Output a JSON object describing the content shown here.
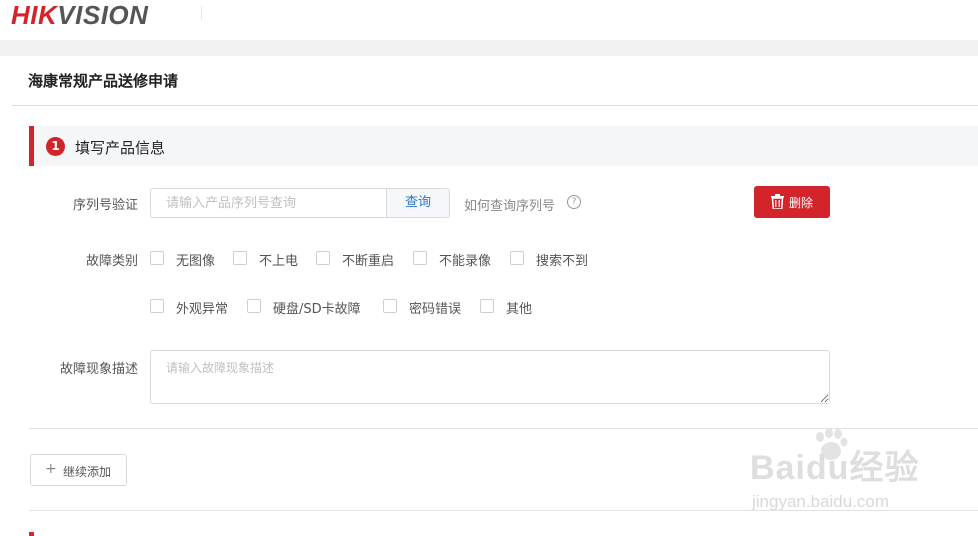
{
  "brand": {
    "logo_part1": "HIK",
    "logo_part2": "VISION"
  },
  "page": {
    "title": "海康常规产品送修申请"
  },
  "section1": {
    "step": "1",
    "title": "填写产品信息",
    "serial": {
      "label": "序列号验证",
      "placeholder": "请输入产品序列号查询",
      "value": "",
      "query_label": "查询",
      "howto_label": "如何查询序列号",
      "help_glyph": "?"
    },
    "delete_label": "删除",
    "fault_type": {
      "label": "故障类别",
      "options": [
        {
          "label": "无图像",
          "checked": false
        },
        {
          "label": "不上电",
          "checked": false
        },
        {
          "label": "不断重启",
          "checked": false
        },
        {
          "label": "不能录像",
          "checked": false
        },
        {
          "label": "搜索不到",
          "checked": false
        },
        {
          "label": "外观异常",
          "checked": false
        },
        {
          "label": "硬盘/SD卡故障",
          "checked": false
        },
        {
          "label": "密码错误",
          "checked": false
        },
        {
          "label": "其他",
          "checked": false
        }
      ]
    },
    "description": {
      "label": "故障现象描述",
      "placeholder": "请输入故障现象描述",
      "value": ""
    },
    "add_more_label": "继续添加",
    "add_icon": "plus-icon"
  },
  "watermark": {
    "line1": "Baidu经验",
    "line2": "jingyan.baidu.com"
  },
  "colors": {
    "accent": "#d3242b",
    "link": "#2f7ac7",
    "section_bg": "#f5f6f8",
    "strip": "#f2f2f2"
  }
}
